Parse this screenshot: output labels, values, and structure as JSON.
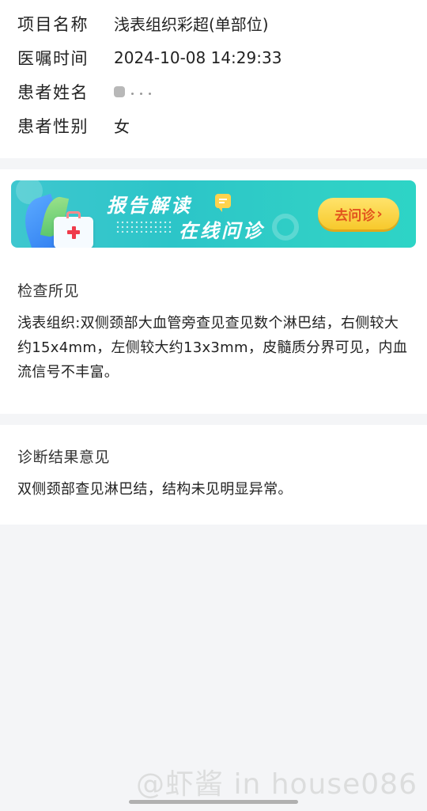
{
  "info": {
    "rows": [
      {
        "label": "项目名称",
        "value": "浅表组织彩超(单部位)"
      },
      {
        "label": "医嘱时间",
        "value": "2024-10-08 14:29:33"
      },
      {
        "label": "患者姓名",
        "value": ""
      },
      {
        "label": "患者性别",
        "value": "女"
      }
    ]
  },
  "banner": {
    "title": "报告解读",
    "subtitle": "在线问诊",
    "button_label": "去问诊",
    "button_chevron": "›",
    "colors": {
      "bg": "#2cc5c8",
      "button": "#f7c92c",
      "button_text": "#e2531d"
    }
  },
  "findings": {
    "title": "检查所见",
    "text": "浅表组织:双侧颈部大血管旁查见查见数个淋巴结，右侧较大约15x4mm，左侧较大约13x3mm，皮髓质分界可见，内血流信号不丰富。"
  },
  "diagnosis": {
    "title": "诊断结果意见",
    "text": "双侧颈部查见淋巴结，结构未见明显异常。"
  },
  "watermark": "@虾酱 in house086"
}
